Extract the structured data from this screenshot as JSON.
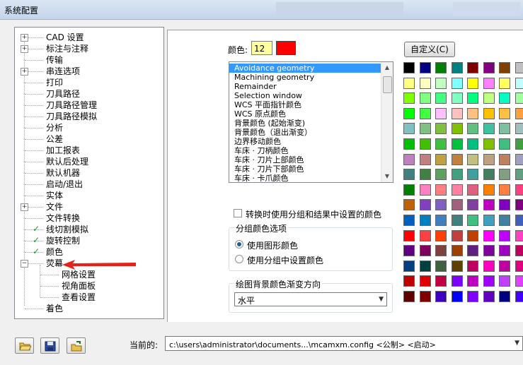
{
  "window": {
    "title": "系统配置"
  },
  "tree": {
    "items": [
      {
        "label": "CAD 设置",
        "expander": "+",
        "check": false
      },
      {
        "label": "标注与注释",
        "expander": "+",
        "check": false
      },
      {
        "label": "传输",
        "expander": "",
        "check": false
      },
      {
        "label": "串连选项",
        "expander": "+",
        "check": false
      },
      {
        "label": "打印",
        "expander": "",
        "check": false
      },
      {
        "label": "刀具路径",
        "expander": "",
        "check": false
      },
      {
        "label": "刀具路径管理",
        "expander": "",
        "check": false
      },
      {
        "label": "刀具路径模拟",
        "expander": "",
        "check": false
      },
      {
        "label": "分析",
        "expander": "",
        "check": false
      },
      {
        "label": "公差",
        "expander": "",
        "check": false
      },
      {
        "label": "加工报表",
        "expander": "",
        "check": false
      },
      {
        "label": "默认后处理",
        "expander": "",
        "check": false
      },
      {
        "label": "默认机器",
        "expander": "",
        "check": false
      },
      {
        "label": "启动/退出",
        "expander": "",
        "check": false
      },
      {
        "label": "实体",
        "expander": "",
        "check": false
      },
      {
        "label": "文件",
        "expander": "+",
        "check": false
      },
      {
        "label": "文件转换",
        "expander": "",
        "check": false
      },
      {
        "label": "线切割模拟",
        "expander": "",
        "check": true
      },
      {
        "label": "旋转控制",
        "expander": "",
        "check": true
      },
      {
        "label": "颜色",
        "expander": "",
        "check": true
      },
      {
        "label": "荧幕",
        "expander": "−",
        "check": false
      },
      {
        "label": "网格设置",
        "child": true
      },
      {
        "label": "视角面板",
        "child": true
      },
      {
        "label": "查看设置",
        "child": true
      },
      {
        "label": "着色",
        "expander": "",
        "check": false
      }
    ]
  },
  "color_panel": {
    "color_label": "颜色:",
    "color_value": "12",
    "current_color": "#ff0000",
    "custom_button": "自定义(C)",
    "list_items": [
      "Avoidance geometry",
      "Machining geometry",
      "Remainder",
      "Selection window",
      "WCS 平面指针颜色",
      "WCS 原点颜色",
      "背景颜色 (起始渐变)",
      "背景颜色（退出渐变）",
      "边界移动颜色",
      "车床 · 刀柄颜色",
      "车床 · 刀片上部颜色",
      "车床 · 刀片下部颜色",
      "车床 · 卡爪颜色"
    ],
    "selected_index": 0,
    "convert_checkbox_label": "转换时使用分组和结果中设置的颜色",
    "group_box_title": "分组颜色选项",
    "radio_options": [
      "使用图形颜色",
      "使用分组中设置颜色"
    ],
    "radio_selected": 0,
    "gradient_title": "绘图背景颜色渐变方向",
    "gradient_value": "水平"
  },
  "palette": [
    [
      "#000000",
      "#000080",
      "#008000",
      "#008080",
      "#800000",
      "#800080",
      "#804000",
      "#c0c0c0",
      "#808080"
    ],
    [
      "#ffff80",
      "#ffffc0",
      "#c0ffc0",
      "#80ffff",
      "#ffff00",
      "#ff80ff",
      "#ffff60",
      "#c0ffff",
      "#e0e0e0"
    ],
    [
      "#80ff00",
      "#80ff80",
      "#40ff80",
      "#80ffc0",
      "#00ff80",
      "#c0ff80",
      "#00ffc0",
      "#a0ffa0",
      "#80ffff"
    ],
    [
      "#00ff00",
      "#40ff40",
      "#ffc0ff",
      "#ffc0c0",
      "#ffc080",
      "#ffc000",
      "#ffc040",
      "#ffa040",
      "#ff8040"
    ],
    [
      "#80c0c0",
      "#80c080",
      "#80c040",
      "#80c000",
      "#60c080",
      "#40c0a0",
      "#80c0a0",
      "#a0c0c0",
      "#a0c0e0"
    ],
    [
      "#00c000",
      "#40c000",
      "#40c040",
      "#00c040",
      "#00c080",
      "#80c000",
      "#40c080",
      "#40a040",
      "#40c0c0"
    ],
    [
      "#c080c0",
      "#c08080",
      "#c0a040",
      "#c08040",
      "#c0c080",
      "#c0a080",
      "#c08060",
      "#a0a0c0",
      "#8080c0"
    ],
    [
      "#408080",
      "#408040",
      "#60a060",
      "#40a080",
      "#40a0a0",
      "#408060",
      "#80a080",
      "#60a080",
      "#60a0a0"
    ],
    [
      "#008000",
      "#ff80c0",
      "#ff8080",
      "#ff80a0",
      "#e06080",
      "#ff8000",
      "#ff8040",
      "#ff4080",
      "#c04080"
    ],
    [
      "#c06000",
      "#8040c0",
      "#8060c0",
      "#a06080",
      "#8040a0",
      "#c000c0",
      "#8000c0",
      "#800080",
      "#a040a0"
    ],
    [
      "#0060c0",
      "#0080c0",
      "#4080c0",
      "#408080",
      "#40c080",
      "#40a0c0",
      "#4080a0",
      "#4060c0",
      "#00c0c0"
    ],
    [
      "#ff0000",
      "#ff4040",
      "#ff4000",
      "#c04040",
      "#c04000",
      "#ff00ff",
      "#c000ff",
      "#ff40c0",
      "#ff0080"
    ],
    [
      "#600080",
      "#800060",
      "#804040",
      "#a04000",
      "#602080",
      "#8000a0",
      "#a000c0",
      "#c00060",
      "#e000a0"
    ],
    [
      "#004080",
      "#004040",
      "#406040",
      "#604000",
      "#c00060",
      "#ff00c0",
      "#c000a0",
      "#e00080",
      "#ff0040"
    ],
    [
      "#c00000",
      "#e00000",
      "#c00040",
      "#8000ff",
      "#c000c0",
      "#a000ff",
      "#c040ff",
      "#e040ff",
      "#ff40ff"
    ],
    [
      "#600000",
      "#800000",
      "#4000c0",
      "#0000ff",
      "#8000ff",
      "#6000c0",
      "#000080",
      "#4000ff",
      "#a040c0"
    ]
  ],
  "footer": {
    "current_label": "当前的:",
    "current_path": "c:\\users\\administrator\\documents...\\mcamxm.config <公制> <启动>"
  }
}
